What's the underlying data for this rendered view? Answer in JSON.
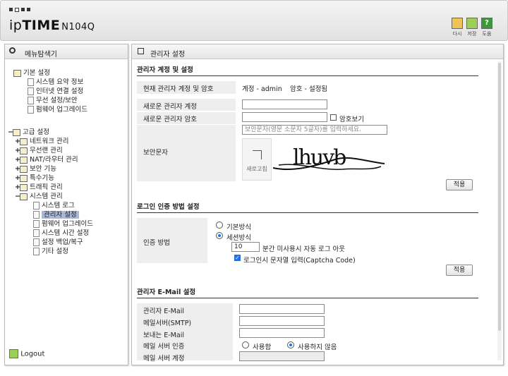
{
  "header": {
    "logo_prefix": "ip",
    "logo_brand": "TIME",
    "model": "N104Q",
    "buttons": [
      {
        "label": "다시",
        "icon": "refresh-icon",
        "color": "#e8b84a"
      },
      {
        "label": "저장",
        "icon": "save-icon",
        "color": "#8dc63f"
      },
      {
        "label": "도움",
        "icon": "help-icon",
        "color": "#3a9a3a"
      }
    ]
  },
  "sidebar": {
    "title": "메뉴탐색기",
    "basic": {
      "label": "기본 설정",
      "items": [
        "시스템 요약 정보",
        "인터넷 연결 설정",
        "무선 설정/보안",
        "펌웨어 업그레이드"
      ]
    },
    "advanced": {
      "label": "고급 설정",
      "items": [
        "네트워크 관리",
        "무선랜 관리",
        "NAT/라우터 관리",
        "보안 기능",
        "특수기능",
        "트래픽 관리",
        "시스템 관리"
      ],
      "system_items": [
        "시스템 로그",
        "관리자 설정",
        "펌웨어 업그레이드",
        "시스템 시간 설정",
        "설정 백업/복구",
        "기타 설정"
      ],
      "selected": "관리자 설정"
    },
    "logout": "Logout"
  },
  "main": {
    "title": "관리자 설정",
    "account": {
      "section": "관리자 계정 및 설정",
      "current_label": "현재 관리자 계정 및 암호",
      "current_value": "계정 - admin",
      "current_pw": "암호 - 설정됨",
      "new_id_label": "새로운 관리자 계정",
      "new_pw_label": "새로운 관리자 암호",
      "show_pw_label": "암호보기",
      "captcha_label": "보안문자",
      "captcha_placeholder": "보안문자(영문 소문자 5글자)를 입력하세요.",
      "captcha_text": "lhuvb",
      "refresh_label": "새로고침",
      "apply": "적용"
    },
    "login": {
      "section": "로그인 인증 방법 설정",
      "method_label": "인증 방법",
      "option_basic": "기본방식",
      "option_session": "세션방식",
      "timeout_value": "10",
      "timeout_suffix": "분간 미사용시 자동 로그 아웃",
      "captcha_check": "로그인시 문자열 입력(Captcha Code)",
      "apply": "적용"
    },
    "email": {
      "section": "관리자 E-Mail 설정",
      "admin_email": "관리자 E-Mail",
      "smtp": "메일서버(SMTP)",
      "sender": "보내는 E-Mail",
      "auth": "메일 서버 인증",
      "use": "사용함",
      "nouse": "사용하지 않음",
      "account": "메일 서버 계정"
    }
  }
}
